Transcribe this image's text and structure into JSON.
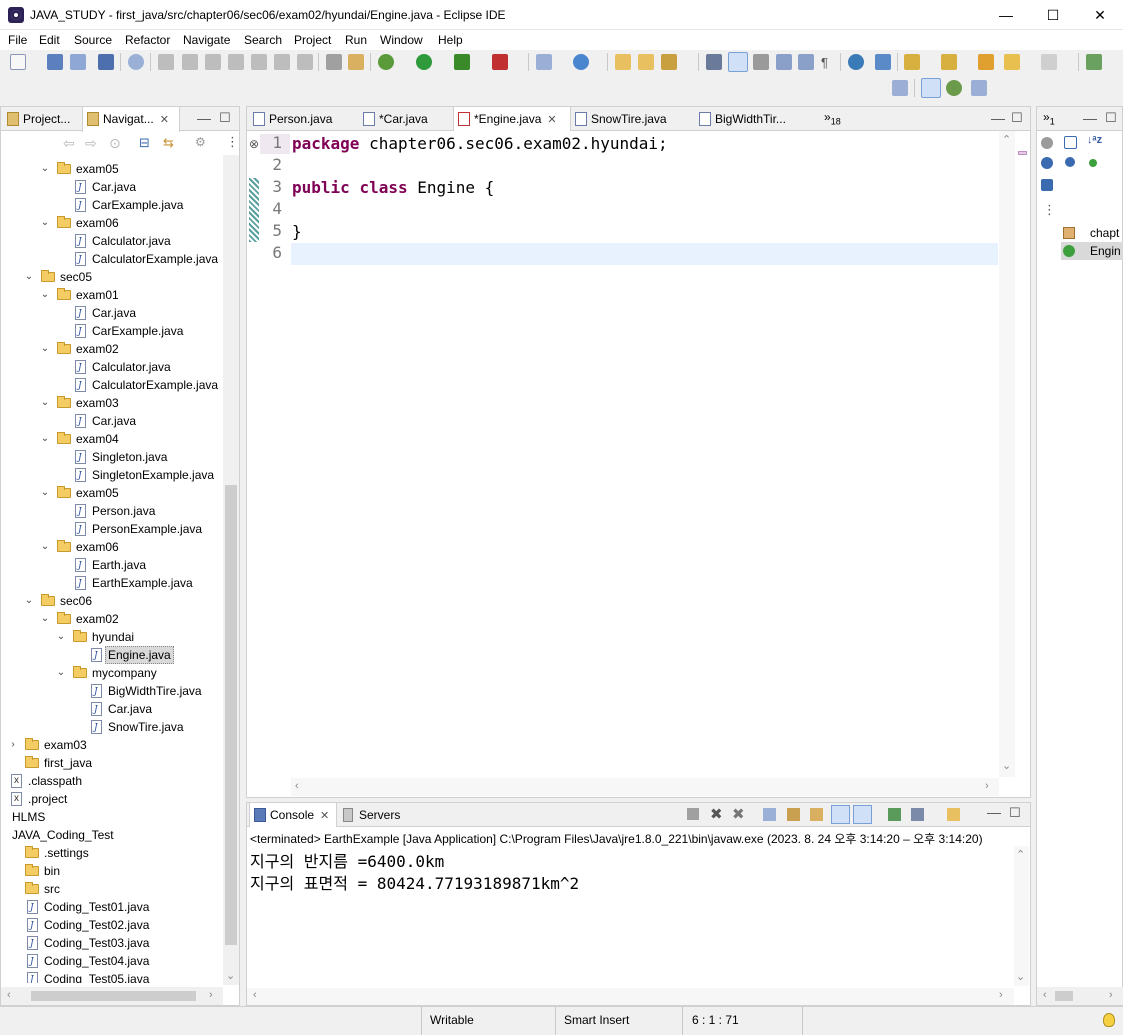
{
  "window": {
    "title": "JAVA_STUDY - first_java/src/chapter06/sec06/exam02/hyundai/Engine.java - Eclipse IDE",
    "minimize": "—",
    "maximize": "☐",
    "close": "✕"
  },
  "menu": [
    "File",
    "Edit",
    "Source",
    "Refactor",
    "Navigate",
    "Search",
    "Project",
    "Run",
    "Window",
    "Help"
  ],
  "left_panel": {
    "tabs": [
      {
        "label": "Project..."
      },
      {
        "label": "Navigat..."
      }
    ],
    "tree": [
      {
        "label": "exam05",
        "type": "folder",
        "expanded": true
      },
      {
        "label": "Car.java",
        "type": "java"
      },
      {
        "label": "CarExample.java",
        "type": "java"
      },
      {
        "label": "exam06",
        "type": "folder",
        "expanded": true
      },
      {
        "label": "Calculator.java",
        "type": "java"
      },
      {
        "label": "CalculatorExample.java",
        "type": "java"
      },
      {
        "label": "sec05",
        "type": "folder",
        "expanded": true
      },
      {
        "label": "exam01",
        "type": "folder",
        "expanded": true
      },
      {
        "label": "Car.java",
        "type": "java"
      },
      {
        "label": "CarExample.java",
        "type": "java"
      },
      {
        "label": "exam02",
        "type": "folder",
        "expanded": true
      },
      {
        "label": "Calculator.java",
        "type": "java"
      },
      {
        "label": "CalculatorExample.java",
        "type": "java"
      },
      {
        "label": "exam03",
        "type": "folder",
        "expanded": true
      },
      {
        "label": "Car.java",
        "type": "java"
      },
      {
        "label": "exam04",
        "type": "folder",
        "expanded": true
      },
      {
        "label": "Singleton.java",
        "type": "java"
      },
      {
        "label": "SingletonExample.java",
        "type": "java"
      },
      {
        "label": "exam05",
        "type": "folder",
        "expanded": true
      },
      {
        "label": "Person.java",
        "type": "java"
      },
      {
        "label": "PersonExample.java",
        "type": "java"
      },
      {
        "label": "exam06",
        "type": "folder",
        "expanded": true
      },
      {
        "label": "Earth.java",
        "type": "java"
      },
      {
        "label": "EarthExample.java",
        "type": "java"
      },
      {
        "label": "sec06",
        "type": "folder",
        "expanded": true
      },
      {
        "label": "exam02",
        "type": "folder",
        "expanded": true
      },
      {
        "label": "hyundai",
        "type": "folder",
        "expanded": true
      },
      {
        "label": "Engine.java",
        "type": "java",
        "selected": true
      },
      {
        "label": "mycompany",
        "type": "folder",
        "expanded": true
      },
      {
        "label": "BigWidthTire.java",
        "type": "java"
      },
      {
        "label": "Car.java",
        "type": "java"
      },
      {
        "label": "SnowTire.java",
        "type": "java"
      },
      {
        "label": "exam03",
        "type": "folder",
        "expanded": false
      },
      {
        "label": "first_java",
        "type": "folder",
        "expanded": null
      },
      {
        "label": ".classpath",
        "type": "x"
      },
      {
        "label": ".project",
        "type": "x"
      },
      {
        "label": "HLMS",
        "type": "project"
      },
      {
        "label": "JAVA_Coding_Test",
        "type": "project"
      },
      {
        "label": ".settings",
        "type": "folder",
        "expanded": null
      },
      {
        "label": "bin",
        "type": "folder",
        "expanded": null
      },
      {
        "label": "src",
        "type": "folder",
        "expanded": null
      },
      {
        "label": "Coding_Test01.java",
        "type": "java"
      },
      {
        "label": "Coding_Test02.java",
        "type": "java"
      },
      {
        "label": "Coding_Test03.java",
        "type": "java"
      },
      {
        "label": "Coding_Test04.java",
        "type": "java"
      },
      {
        "label": "Coding_Test05.java",
        "type": "java"
      }
    ]
  },
  "editor": {
    "tabs": [
      {
        "label": "Person.java",
        "active": false
      },
      {
        "label": "*Car.java",
        "active": false
      },
      {
        "label": "*Engine.java",
        "active": true
      },
      {
        "label": "SnowTire.java",
        "active": false
      },
      {
        "label": "BigWidthTir..."
      }
    ],
    "overflow_count": "18",
    "line_numbers": [
      "1",
      "2",
      "3",
      "4",
      "5",
      "6"
    ],
    "code": {
      "line1_kw": "package",
      "line1_rest": " chapter06.sec06.exam02.hyundai;",
      "line3_kw1": "public",
      "line3_kw2": "class",
      "line3_rest": " Engine {",
      "line5": "}"
    }
  },
  "outline": {
    "items": [
      "chapt",
      "Engin"
    ],
    "tab_count": "1"
  },
  "console": {
    "tabs": [
      {
        "label": "Console",
        "active": true
      },
      {
        "label": "Servers",
        "active": false
      }
    ],
    "header": "<terminated> EarthExample [Java Application] C:\\Program Files\\Java\\jre1.8.0_221\\bin\\javaw.exe  (2023. 8. 24 오후 3:14:20 – 오후 3:14:20)",
    "output": [
      "지구의 반지름 =6400.0km",
      "지구의 표면적 = 80424.77193189871km^2"
    ]
  },
  "status": {
    "writable": "Writable",
    "insert_mode": "Smart Insert",
    "position": "6 : 1 : 71"
  }
}
